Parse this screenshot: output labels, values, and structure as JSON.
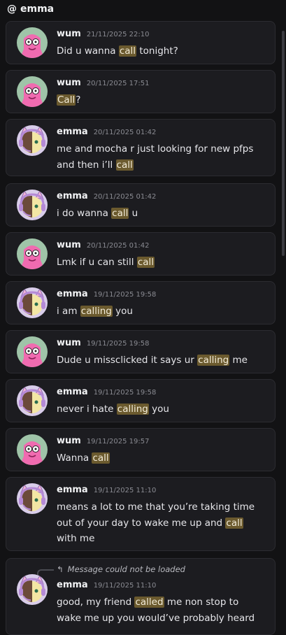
{
  "header": {
    "at_symbol": "@",
    "title": "emma"
  },
  "messages": [
    {
      "author": "wum",
      "timestamp": "21/11/2025 22:10",
      "avatar": "pink-avatar",
      "segments": [
        {
          "t": "Did u wanna "
        },
        {
          "t": "call",
          "h": true
        },
        {
          "t": " tonight?"
        }
      ]
    },
    {
      "author": "wum",
      "timestamp": "20/11/2025 17:51",
      "avatar": "pink-avatar",
      "segments": [
        {
          "t": "Call",
          "h": true
        },
        {
          "t": "?"
        }
      ]
    },
    {
      "author": "emma",
      "timestamp": "20/11/2025 01:42",
      "avatar": "headset-avatar",
      "segments": [
        {
          "t": "me and mocha r just looking for new pfps and then i’ll "
        },
        {
          "t": "call",
          "h": true
        }
      ]
    },
    {
      "author": "emma",
      "timestamp": "20/11/2025 01:42",
      "avatar": "headset-avatar",
      "segments": [
        {
          "t": "i do wanna "
        },
        {
          "t": "call",
          "h": true
        },
        {
          "t": " u"
        }
      ]
    },
    {
      "author": "wum",
      "timestamp": "20/11/2025 01:42",
      "avatar": "pink-avatar",
      "segments": [
        {
          "t": "Lmk if u can still "
        },
        {
          "t": "call",
          "h": true
        }
      ]
    },
    {
      "author": "emma",
      "timestamp": "19/11/2025 19:58",
      "avatar": "headset-avatar",
      "segments": [
        {
          "t": "i am "
        },
        {
          "t": "calling",
          "h": true
        },
        {
          "t": " you"
        }
      ]
    },
    {
      "author": "wum",
      "timestamp": "19/11/2025 19:58",
      "avatar": "pink-avatar",
      "segments": [
        {
          "t": "Dude u missclicked it says ur "
        },
        {
          "t": "calling",
          "h": true
        },
        {
          "t": " me"
        }
      ]
    },
    {
      "author": "emma",
      "timestamp": "19/11/2025 19:58",
      "avatar": "headset-avatar",
      "segments": [
        {
          "t": "never i hate "
        },
        {
          "t": "calling",
          "h": true
        },
        {
          "t": " you"
        }
      ]
    },
    {
      "author": "wum",
      "timestamp": "19/11/2025 19:57",
      "avatar": "pink-avatar",
      "segments": [
        {
          "t": "Wanna "
        },
        {
          "t": "call",
          "h": true
        }
      ]
    },
    {
      "author": "emma",
      "timestamp": "19/11/2025 11:10",
      "avatar": "headset-avatar",
      "segments": [
        {
          "t": "means a lot to me that you’re taking time out of your day to wake me up and "
        },
        {
          "t": "call",
          "h": true
        },
        {
          "t": " with me"
        }
      ]
    },
    {
      "author": "emma",
      "timestamp": "19/11/2025 11:10",
      "avatar": "headset-avatar",
      "reply_text": "Message could not be loaded",
      "segments": [
        {
          "t": "good, my friend "
        },
        {
          "t": "called",
          "h": true
        },
        {
          "t": " me non stop to wake me up you would’ve probably heard"
        }
      ]
    }
  ],
  "colors": {
    "background": "#121214",
    "card": "#1c1c20",
    "highlight": "#6b5a2e",
    "pink_avatar_bg": "#f06bb0",
    "headset_avatar_bg": "#d9cdea"
  }
}
